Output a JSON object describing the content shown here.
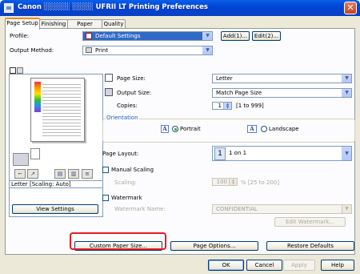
{
  "window": {
    "title": "Canon ░░░░░ ░░░░ UFRII LT Printing Preferences",
    "close_label": "✕"
  },
  "tabs": [
    "Page Setup",
    "Finishing",
    "Paper Source",
    "Quality"
  ],
  "profile": {
    "label": "Profile:",
    "value": "Default Settings",
    "add_label": "Add(1)...",
    "edit_label": "Edit(2)..."
  },
  "output_method": {
    "label": "Output Method:",
    "value": "Print"
  },
  "preview": {
    "caption": "Letter [Scaling: Auto]",
    "view_settings_label": "View Settings"
  },
  "page_size": {
    "label": "Page Size:",
    "value": "Letter"
  },
  "output_size": {
    "label": "Output Size:",
    "value": "Match Page Size"
  },
  "copies": {
    "label": "Copies:",
    "value": "1",
    "range": "[1 to 999]"
  },
  "orientation": {
    "label": "Orientation",
    "portrait": "Portrait",
    "landscape": "Landscape",
    "selected": "Portrait"
  },
  "page_layout": {
    "label": "Page Layout:",
    "icon_text": "1",
    "value": "1 on 1"
  },
  "manual_scaling": {
    "label": "Manual Scaling",
    "checked": false,
    "scaling_label": "Scaling:",
    "value": "100",
    "range": "% [25 to 200]"
  },
  "watermark": {
    "label": "Watermark",
    "checked": false,
    "name_label": "Watermark Name:",
    "name_value": "CONFIDENTIAL",
    "edit_label": "Edit Watermark..."
  },
  "bottom_buttons": {
    "custom_paper_size": "Custom Paper Size...",
    "page_options": "Page Options...",
    "restore_defaults": "Restore Defaults"
  },
  "dialog_buttons": {
    "ok": "OK",
    "cancel": "Cancel",
    "apply": "Apply",
    "help": "Help"
  },
  "colors": {
    "highlight": "#e31b23",
    "titlebar": "#0046d5",
    "selected": "#316ac5"
  }
}
